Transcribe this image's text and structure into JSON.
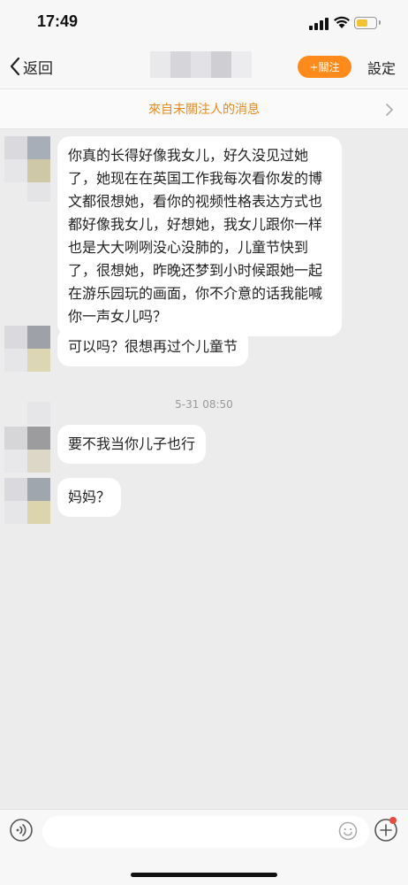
{
  "status": {
    "time": "17:49"
  },
  "nav": {
    "back_label": "返回",
    "follow_label": "+關注",
    "settings_label": "設定"
  },
  "banner": {
    "text": "來自未關注人的消息"
  },
  "messages": [
    {
      "text": "你真的长得好像我女儿，好久没见过她了，她现在在英国工作我每次看你发的博文都很想她，看你的视频性格表达方式也都好像我女儿，好想她，我女儿跟你一样也是大大咧咧没心没肺的，儿童节快到了，很想她，昨晚还梦到小时候跟她一起在游乐园玩的画面，你不介意的话我能喊你一声女儿吗？"
    },
    {
      "text": "可以吗？很想再过个儿童节"
    },
    {
      "text": "要不我当你儿子也行"
    },
    {
      "text": "妈妈？"
    }
  ],
  "timestamp": "5-31 08:50",
  "input": {
    "value": "",
    "placeholder": ""
  },
  "colors": {
    "accent": "#ff8a1c",
    "banner_text": "#e88a1c",
    "chat_background": "#ececec",
    "bubble": "#ffffff",
    "notification_dot": "#e94b3c",
    "battery_fill": "#f2c230"
  },
  "icons": {
    "back": "chevron-left-icon",
    "banner": "chevron-right-icon",
    "voice": "voice-icon",
    "emoji": "emoji-icon",
    "plus": "plus-icon"
  }
}
